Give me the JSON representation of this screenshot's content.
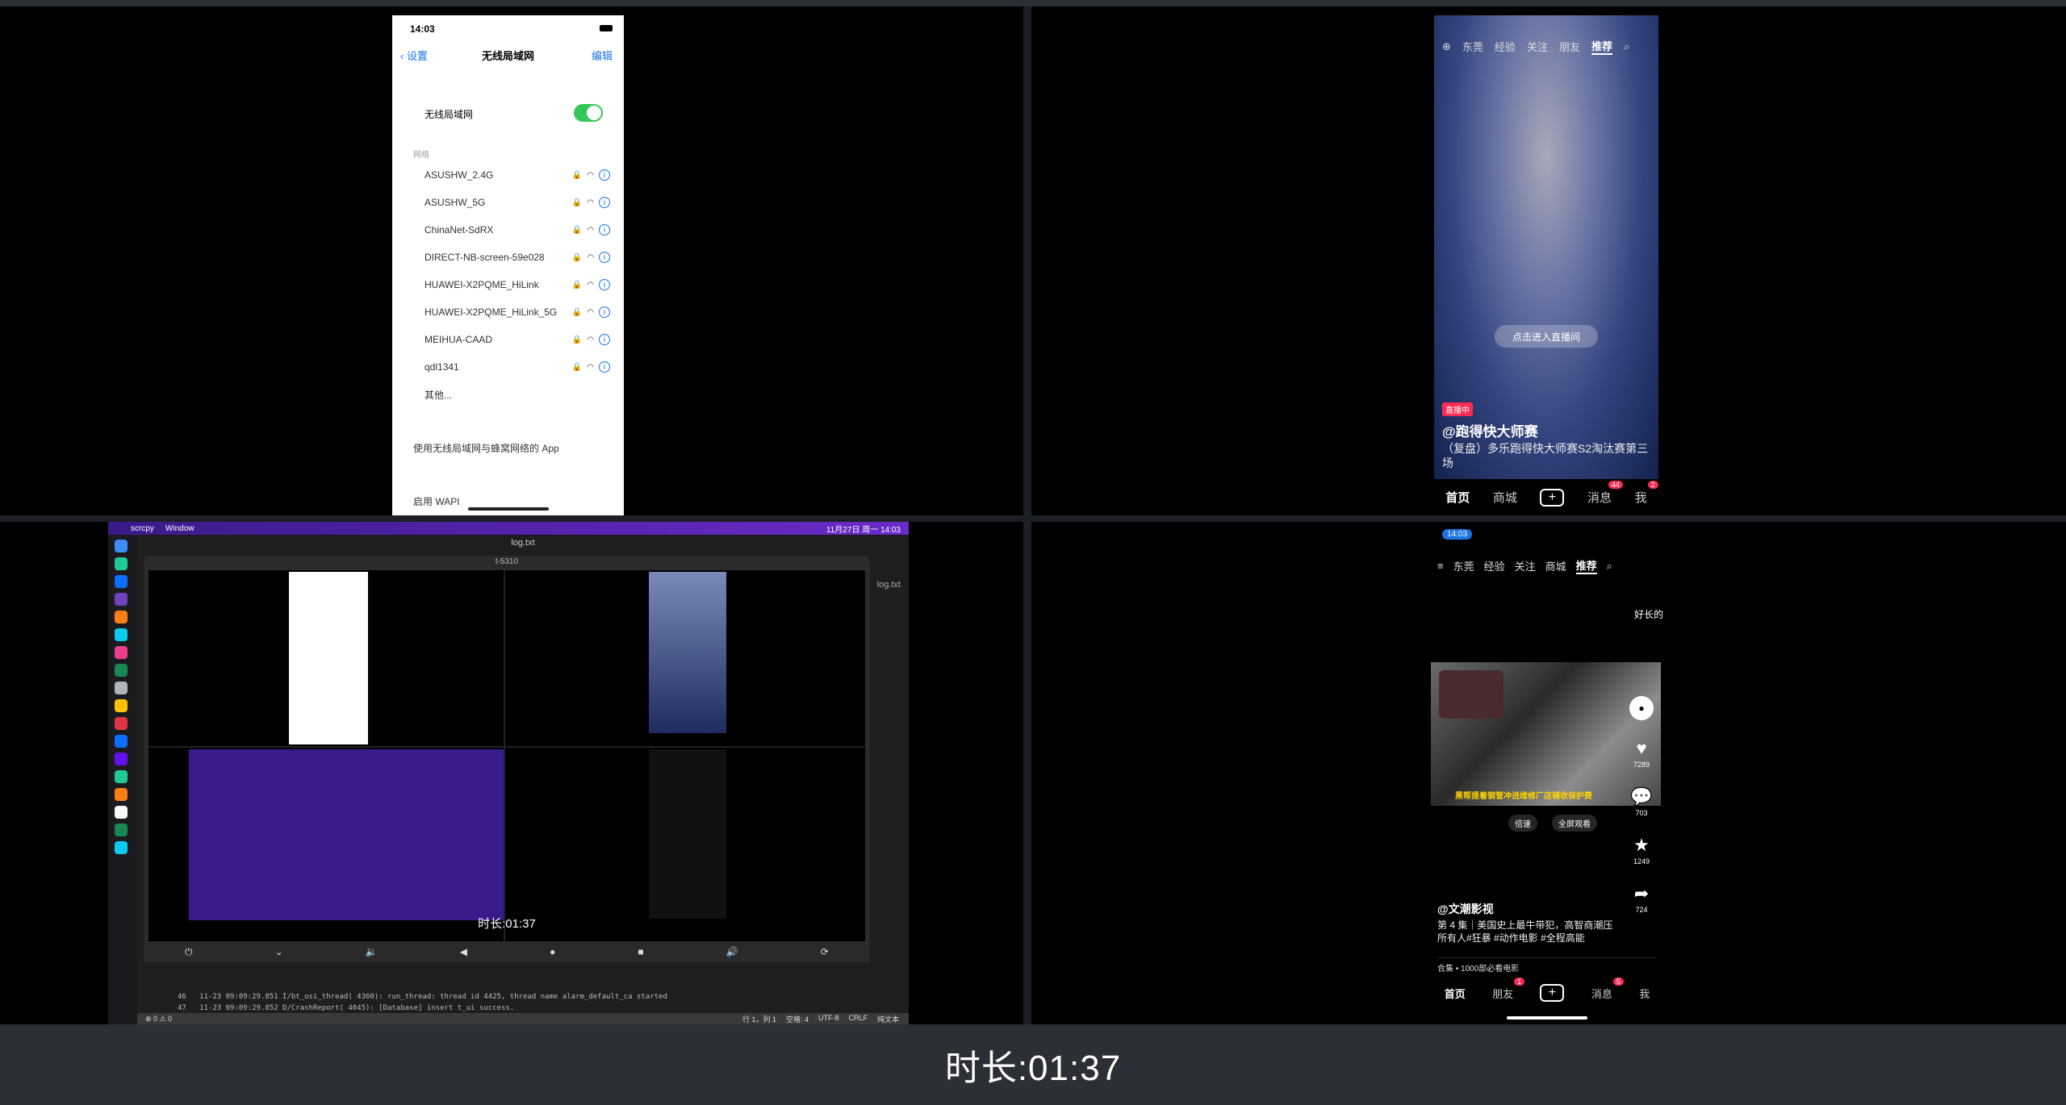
{
  "recording": {
    "duration_label": "时长:01:37"
  },
  "iphone": {
    "time": "14:03",
    "back": "设置",
    "title": "无线局域网",
    "edit": "编辑",
    "wifi_label": "无线局域网",
    "networks_header": "网络",
    "networks": [
      "ASUSHW_2.4G",
      "ASUSHW_5G",
      "ChinaNet-SdRX",
      "DIRECT-NB-screen-59e028",
      "HUAWEI-X2PQME_HiLink",
      "HUAWEI-X2PQME_HiLink_5G",
      "MEIHUA-CAAD",
      "qdl1341"
    ],
    "other": "其他...",
    "apps_label": "使用无线局域网与蜂窝网络的 App",
    "wapi_label": "启用 WAPI"
  },
  "douyin_top": {
    "tabs": [
      "东莞",
      "经验",
      "关注",
      "朋友",
      "推荐"
    ],
    "live_button": "点击进入直播间",
    "badge": "直播中",
    "author": "@跑得快大师赛",
    "desc": "（复盘）多乐跑得快大师赛S2淘汰赛第三场",
    "nav": {
      "home": "首页",
      "mall": "商城",
      "messages": "消息",
      "msg_badge": "44",
      "me": "我",
      "me_badge": "2"
    }
  },
  "mac": {
    "menu": [
      "scrcpy",
      "Window"
    ],
    "menu_time": "11月27日 周一 14:03",
    "vscode_title": "log.txt",
    "scrcpy_title": "t-5310",
    "inner_duration": "时长:01:37",
    "log_tab": "log.txt",
    "log_lines": [
      "46   11-23 09:09:29.851 I/bt_osi_thread( 4360): run_thread: thread id 4425, thread name alarm_default_ca started",
      "47   11-23 09:09:29.852 D/CrashReport( 4045): [Database] insert t_ui success."
    ],
    "status": {
      "errors": "⊗ 0 ⚠ 0",
      "pos": "行 1，列 1",
      "spaces": "空格: 4",
      "enc": "UTF-8",
      "eol": "CRLF",
      "lang": "纯文本"
    }
  },
  "douyin_bottom": {
    "time": "14:03",
    "tabs": [
      "东莞",
      "经验",
      "关注",
      "商城",
      "推荐"
    ],
    "side_text": "好长的",
    "caption": "黑帮提着钢管冲进维修厂店铺收保护费",
    "tools": [
      "倍速",
      "全屏观看"
    ],
    "likes": "7289",
    "comments": "703",
    "favorites": "1249",
    "shares": "724",
    "author": "@文潮影视",
    "desc": "第 4 集｜美国史上最牛带犯，高智商潮压所有人#狂暴 #动作电影 #全程高能",
    "collection": "合集 • 1000部必看电影",
    "nav": {
      "home": "首页",
      "friends": "朋友",
      "friends_badge": "1",
      "messages": "消息",
      "msg_badge": "5",
      "me": "我"
    }
  }
}
